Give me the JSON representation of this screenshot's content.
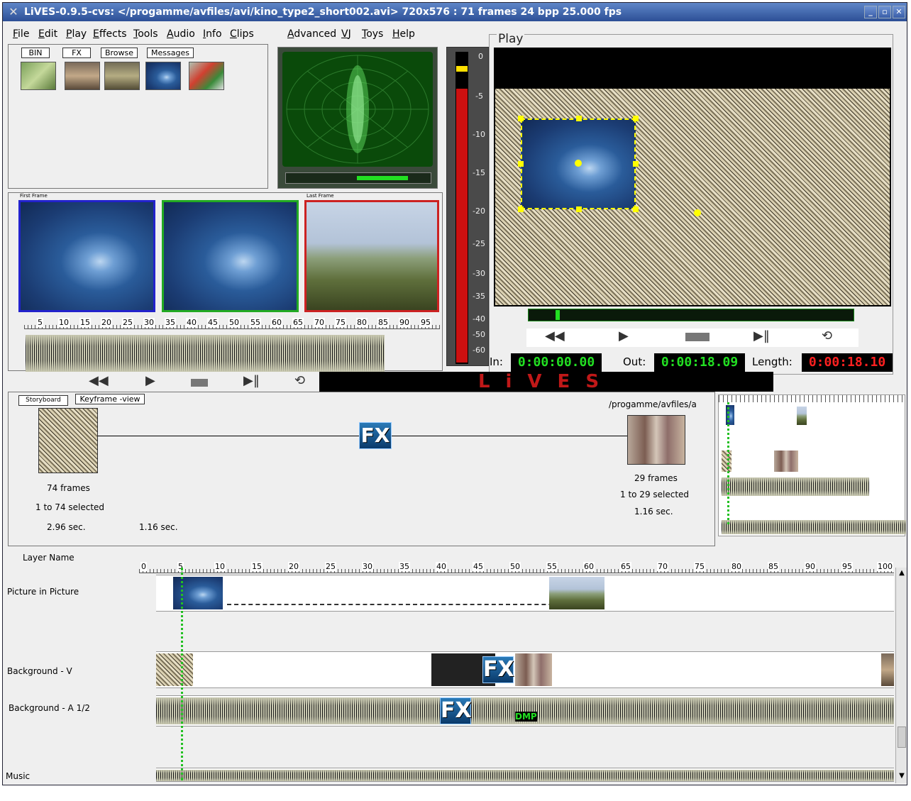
{
  "window": {
    "title": "LiVES-0.9.5-cvs: </progamme/avfiles/avi/kino_type2_short002.avi> 720x576 : 71 frames 24 bpp 25.000 fps",
    "buttons": [
      "minimize-icon",
      "maximize-icon",
      "close-icon"
    ]
  },
  "menu": {
    "items": [
      "File",
      "Edit",
      "Play",
      "Effects",
      "Tools",
      "Audio",
      "Info",
      "Clips",
      "Advanced",
      "VJ",
      "Toys",
      "Help"
    ]
  },
  "clipbin": {
    "tabs": [
      "BIN",
      "FX",
      "Browse",
      "Messages"
    ]
  },
  "frames": {
    "first_label": "First Frame",
    "last_label": "Last Frame"
  },
  "mini_ruler": [
    "5",
    "10",
    "15",
    "20",
    "25",
    "30",
    "35",
    "40",
    "45",
    "50",
    "55",
    "60",
    "65",
    "70",
    "75",
    "80",
    "85",
    "90",
    "95"
  ],
  "meter": {
    "scale": [
      "0",
      "-5",
      "-10",
      "-15",
      "-20",
      "-25",
      "-30",
      "-35",
      "-40",
      "-50",
      "-60"
    ]
  },
  "player": {
    "title": "Play",
    "in_label": "In:",
    "in_value": "0:00:00.00",
    "out_label": "Out:",
    "out_value": "0:00:18.09",
    "length_label": "Length:",
    "length_value": "0:00:18.10",
    "logo": "LiVES"
  },
  "storyboard": {
    "tabs": [
      "Storyboard",
      "Keyframe -view"
    ],
    "left_frames": "74 frames",
    "left_selected": "1 to 74 selected",
    "left_secs": "2.96 sec.",
    "middle_secs": "1.16 sec.",
    "right_path": "/progamme/avfiles/a",
    "right_frames": "29 frames",
    "right_selected": "1 to 29 selected",
    "right_secs": "1.16 sec.",
    "fx_label": "FX"
  },
  "timeline": {
    "header_label": "Layer Name",
    "ruler": [
      "0",
      "5",
      "10",
      "15",
      "20",
      "25",
      "30",
      "35",
      "40",
      "45",
      "50",
      "55",
      "60",
      "65",
      "70",
      "75",
      "80",
      "85",
      "90",
      "95",
      "100"
    ],
    "tracks": [
      "Picture in Picture",
      "Background - V",
      "Background - A 1/2",
      "Music"
    ],
    "fx_label": "FX",
    "dmp_label": "DMP"
  },
  "colors": {
    "title_bar": "#3a5ea8",
    "lcd_green": "#22e022",
    "lcd_red": "#ff2020",
    "meter_red": "#cc1010",
    "playhead_green": "#22c022"
  }
}
